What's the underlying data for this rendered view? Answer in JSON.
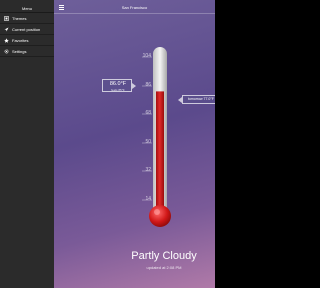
{
  "drawer": {
    "title": "Menu",
    "items": [
      {
        "label": "Themes",
        "icon": "theme-icon"
      },
      {
        "label": "Current position",
        "icon": "location-icon"
      },
      {
        "label": "Favorites",
        "icon": "star-icon"
      },
      {
        "label": "Settings",
        "icon": "gear-icon"
      }
    ]
  },
  "header": {
    "city": "San Francisco"
  },
  "thermometer": {
    "scale_unit": "F",
    "ticks": [
      "104",
      "86",
      "68",
      "50",
      "32",
      "14"
    ],
    "current_temp": "86.0°F",
    "current_sub": "feels 85°F",
    "current_fill_fraction": 0.76,
    "tomorrow_label": "tomorrow 77.0°F"
  },
  "weather": {
    "condition": "Partly Cloudy",
    "updated": "updated at 2:08 PM"
  },
  "colors": {
    "drawer_bg": "#2b2b2b",
    "mercury": "#d81a1a",
    "background_top": "#6e5f9a",
    "background_bottom": "#b07aa8"
  }
}
